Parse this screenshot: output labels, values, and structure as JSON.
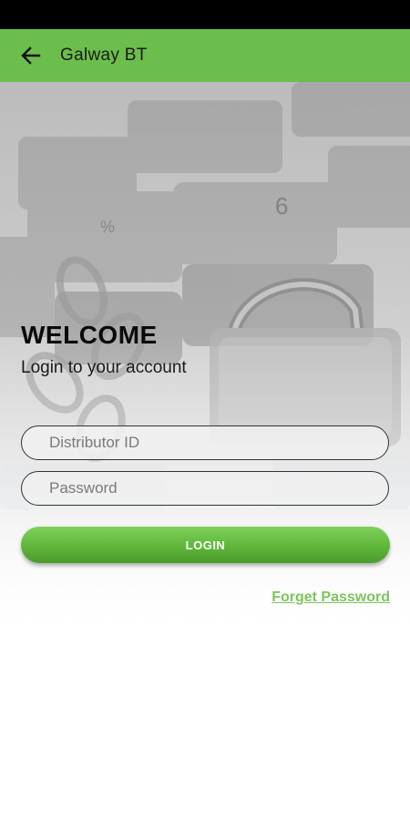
{
  "app_bar": {
    "title": "Galway BT",
    "back_icon": "arrow-left-icon",
    "color": "#6cbe4c"
  },
  "status_bar": {
    "color": "#000000"
  },
  "login": {
    "heading": "WELCOME",
    "subtitle": "Login to your account",
    "distributor_id": {
      "placeholder": "Distributor ID",
      "value": ""
    },
    "password": {
      "placeholder": "Password",
      "value": ""
    },
    "login_button": "LOGIN",
    "forget_password": "Forget Password"
  },
  "colors": {
    "accent": "#6cbe4c",
    "link": "#7cc45d"
  }
}
